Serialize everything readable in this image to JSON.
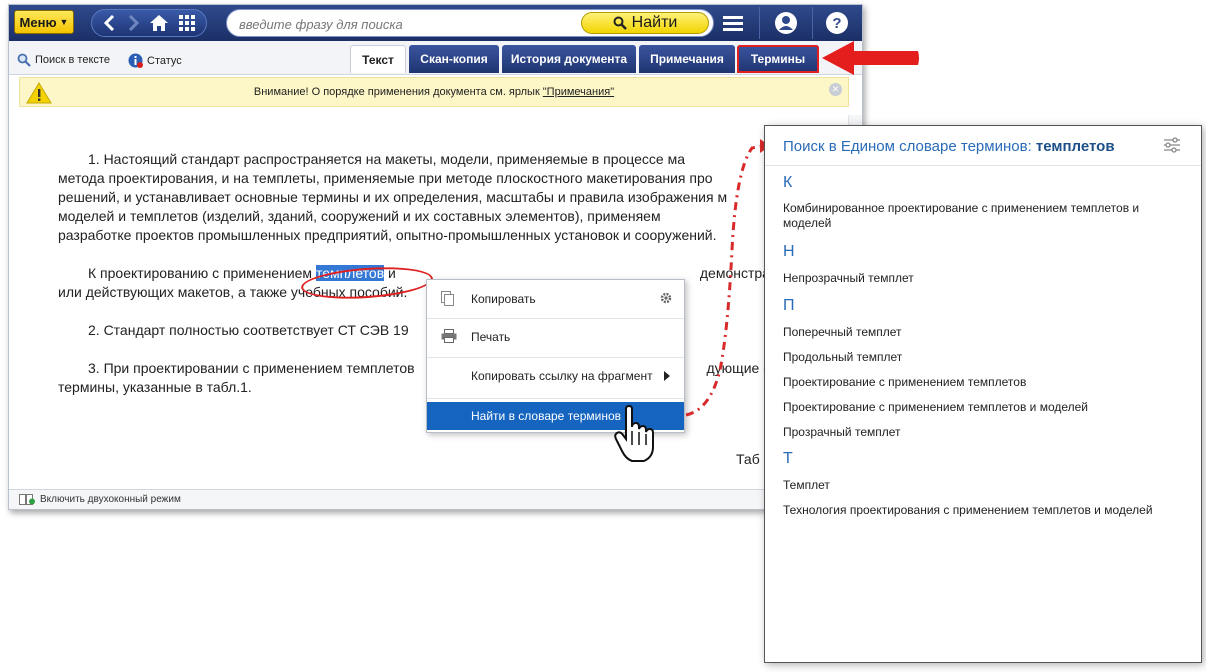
{
  "topbar": {
    "menu_label": "Меню",
    "search_placeholder": "введите фразу для поиска",
    "find_label": "Найти"
  },
  "subbar": {
    "search_in_text": "Поиск в тексте",
    "status": "Статус"
  },
  "tabs": [
    {
      "label": "Текст"
    },
    {
      "label": "Скан-копия"
    },
    {
      "label": "История документа"
    },
    {
      "label": "Примечания"
    },
    {
      "label": "Термины"
    }
  ],
  "warning": {
    "text": "Внимание! О порядке применения документа см. ярлык",
    "link": "\"Примечания\""
  },
  "document": {
    "p1_lines": [
      "1. Настоящий стандарт распространяется на макеты, модели, применяемые в процессе ма",
      "метода проектирования, и на темплеты, применяемые при методе плоскостного макетирования про",
      "решений, и устанавливает основные термины и их определения, масштабы и правила изображения м",
      "моделей и темплетов (изделий, зданий, сооружений и их составных элементов), применяем",
      "разработке проектов промышленных предприятий, опытно-промышленных установок и сооружений."
    ],
    "p2_before": "К проектированию с применением ",
    "p2_selected": "темплетов",
    "p2_after": " и",
    "p2_right": "демонстрац",
    "p2_line2": "или действующих макетов, а также учебных пособий.",
    "p3": "2. Стандарт полностью соответствует СТ СЭВ 19",
    "p4_line1": "3. При проектировании с применением темплетов",
    "p4_right": "дующие ос",
    "p4_line2": "термины, указанные в табл.1.",
    "table_label": "Таб"
  },
  "statusbar": {
    "dual_mode": "Включить двухоконный режим"
  },
  "context_menu": {
    "copy": "Копировать",
    "print": "Печать",
    "copy_link": "Копировать ссылку на фрагмент",
    "find_in_glossary": "Найти в словаре терминов"
  },
  "glossary": {
    "title_prefix": "Поиск в Едином словаре терминов:",
    "title_term": "темплетов",
    "groups": [
      {
        "letter": "К",
        "terms": [
          "Комбинированное проектирование с применением темплетов и моделей"
        ]
      },
      {
        "letter": "Н",
        "terms": [
          "Непрозрачный темплет"
        ]
      },
      {
        "letter": "П",
        "terms": [
          "Поперечный темплет",
          "Продольный темплет",
          "Проектирование с применением темплетов",
          "Проектирование с применением темплетов и моделей",
          "Прозрачный темплет"
        ]
      },
      {
        "letter": "Т",
        "terms": [
          "Темплет",
          "Технология проектирования с применением темплетов и моделей"
        ]
      }
    ]
  },
  "colors": {
    "topbar": "#1b2f66",
    "accent_yellow": "#f4c400",
    "highlight_red": "#e02020",
    "selection_blue": "#1565c0",
    "glossary_blue": "#2a6bb8"
  }
}
